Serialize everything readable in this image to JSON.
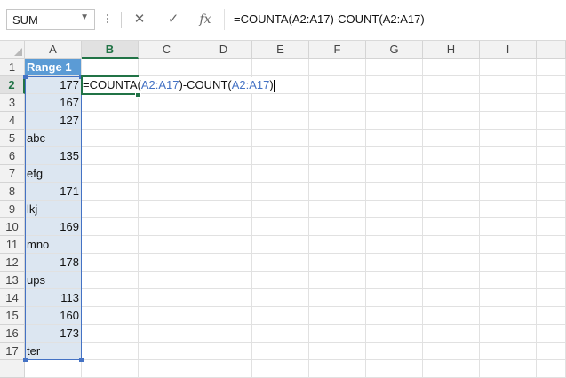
{
  "name_box": {
    "value": "SUM"
  },
  "formula_bar": {
    "cancel_icon": "x-icon",
    "enter_icon": "check-icon",
    "function_label": "fx",
    "formula": "=COUNTA(A2:A17)-COUNT(A2:A17)"
  },
  "columns": [
    "A",
    "B",
    "C",
    "D",
    "E",
    "F",
    "G",
    "H",
    "I"
  ],
  "rows": [
    "1",
    "2",
    "3",
    "4",
    "5",
    "6",
    "7",
    "8",
    "9",
    "10",
    "11",
    "12",
    "13",
    "14",
    "15",
    "16",
    "17"
  ],
  "cells": {
    "A1": "Range 1",
    "A2": "177",
    "A3": "167",
    "A4": "127",
    "A5": "abc",
    "A6": "135",
    "A7": "efg",
    "A8": "171",
    "A9": "lkj",
    "A10": "169",
    "A11": "mno",
    "A12": "178",
    "A13": "ups",
    "A14": "113",
    "A15": "160",
    "A16": "173",
    "A17": "ter"
  },
  "editing": {
    "cell": "B2",
    "part1": "=COUNTA(",
    "ref1": "A2:A17",
    "part2": ")-COUNT(",
    "ref2": "A2:A17",
    "part3": ")"
  },
  "colors": {
    "header_fill": "#5b9bd5",
    "range_fill": "#dce6f1",
    "range_border": "#4472c4",
    "active_green": "#217346"
  }
}
